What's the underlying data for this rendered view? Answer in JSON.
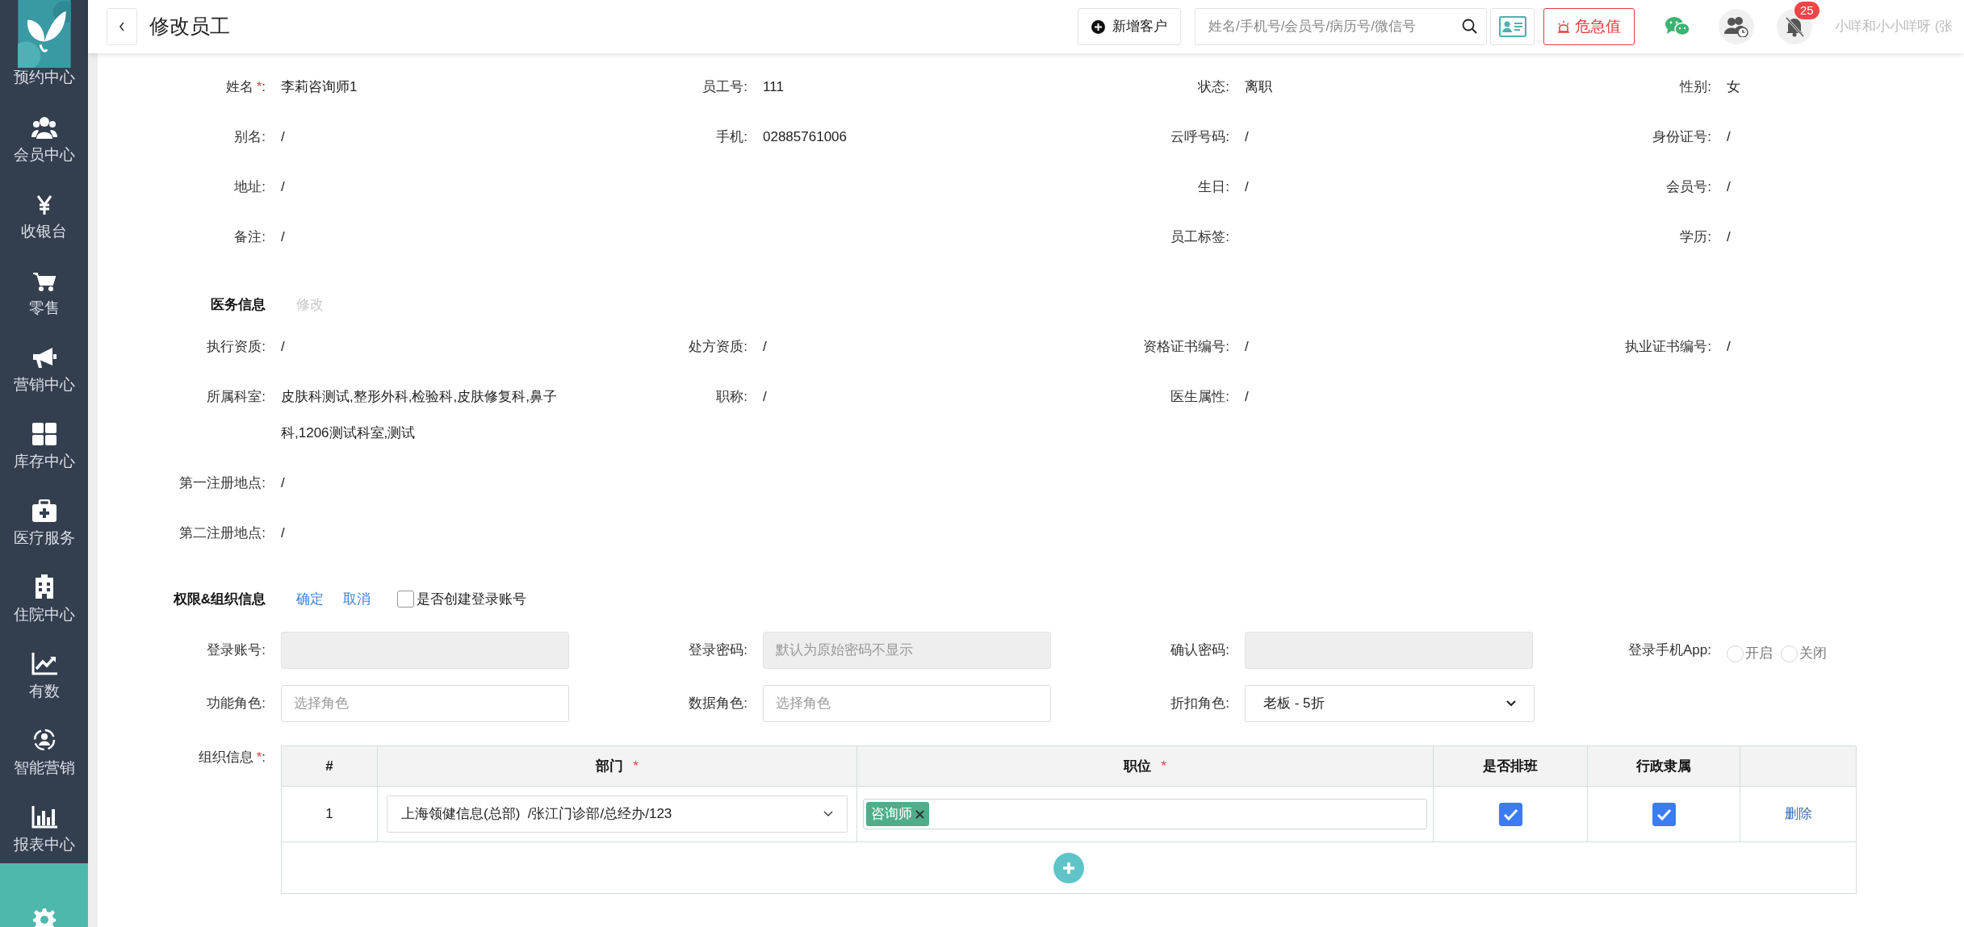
{
  "sidebar": {
    "items": [
      {
        "label": "预约中心",
        "selected": false
      },
      {
        "label": "会员中心",
        "selected": false
      },
      {
        "label": "收银台",
        "selected": false
      },
      {
        "label": "零售",
        "selected": false
      },
      {
        "label": "营销中心",
        "selected": false
      },
      {
        "label": "库存中心",
        "selected": false
      },
      {
        "label": "医疗服务",
        "selected": false
      },
      {
        "label": "住院中心",
        "selected": false
      },
      {
        "label": "有数",
        "selected": false
      },
      {
        "label": "智能营销",
        "selected": false
      },
      {
        "label": "报表中心",
        "selected": false
      },
      {
        "selected": true
      }
    ]
  },
  "header": {
    "title": "修改员工",
    "new_customer_button": "新增客户",
    "search": {
      "placeholder": "姓名/手机号/会员号/病历号/微信号"
    },
    "alert_button": "危急值",
    "notification_count": "25",
    "user_name": "小咩和小小咩呀 (张"
  },
  "basic_info": {
    "rows": [
      [
        {
          "label": "姓名",
          "required_mark": "*",
          "label_end": ":",
          "value": "李莉咨询师1"
        },
        {
          "label": "员工号:",
          "value": "111"
        },
        {
          "label": "状态:",
          "value": "离职"
        },
        {
          "label": "性别:",
          "value": "女"
        }
      ],
      [
        {
          "label": "别名:",
          "value": "/"
        },
        {
          "label": "手机:",
          "value": "02885761006"
        },
        {
          "label": "云呼号码:",
          "value": "/"
        },
        {
          "label": "身份证号:",
          "value": "/"
        }
      ],
      [
        {
          "label": "地址:",
          "value": "/"
        },
        null,
        {
          "label": "生日:",
          "value": "/"
        },
        {
          "label": "会员号:",
          "value": "/"
        }
      ],
      [
        {
          "label": "备注:",
          "value": "/"
        },
        null,
        {
          "label": "员工标签:"
        },
        {
          "label": "学历:",
          "value": "/"
        }
      ]
    ]
  },
  "medical_info": {
    "title": "医务信息",
    "edit_link": {
      "label": "修改",
      "disabled": true
    },
    "rows": [
      [
        {
          "label": "执行资质:",
          "value": "/"
        },
        {
          "label": "处方资质:",
          "value": "/"
        },
        {
          "label": "资格证书编号:",
          "value": "/"
        },
        {
          "label": "执业证书编号:",
          "value": "/"
        }
      ],
      [
        {
          "label": "所属科室:",
          "value": "皮肤科测试,整形外科,检验科,皮肤修复科,鼻子科,1206测试科室,测试"
        },
        {
          "label": "职称:",
          "value": "/"
        },
        {
          "label": "医生属性:",
          "value": "/"
        }
      ],
      [
        {
          "label": "第一注册地点:",
          "value": "/"
        }
      ],
      [
        {
          "label": "第二注册地点:",
          "value": "/"
        }
      ]
    ]
  },
  "permissions": {
    "title": "权限&组织信息",
    "confirm_link": "确定",
    "cancel_link": "取消",
    "create_account": {
      "label": "是否创建登录账号",
      "checked": false
    },
    "form_rows": [
      [
        {
          "kind": "input",
          "label": "登录账号:",
          "disabled": true
        },
        {
          "kind": "input",
          "label": "登录密码:",
          "disabled": true,
          "placeholder": "默认为原始密码不显示"
        },
        {
          "kind": "input",
          "label": "确认密码:",
          "disabled": true
        },
        {
          "kind": "radios",
          "label": "登录手机App:",
          "options": [
            {
              "label": "开启",
              "selected": false
            },
            {
              "label": "关闭",
              "selected": false
            }
          ]
        }
      ],
      [
        {
          "kind": "input",
          "label": "功能角色:",
          "disabled": false,
          "placeholder": "选择角色"
        },
        {
          "kind": "input",
          "label": "数据角色:",
          "disabled": false,
          "placeholder": "选择角色"
        },
        {
          "kind": "select",
          "label": "折扣角色:",
          "value": "老板 - 5折"
        }
      ]
    ],
    "org": {
      "label": "组织信息",
      "required_mark": "*",
      "label_end": ":",
      "columns": [
        {
          "label": "#"
        },
        {
          "label": "部门",
          "required_mark": "*"
        },
        {
          "label": "职位",
          "required_mark": "*"
        },
        {
          "label": "是否排班"
        },
        {
          "label": "行政隶属"
        },
        {}
      ],
      "rows": [
        {
          "index": "1",
          "department": "上海领健信息(总部)  /张江门诊部/总经办/123",
          "positions": [
            "咨询师"
          ],
          "scheduled": true,
          "admin": true,
          "delete_link": "删除"
        }
      ]
    }
  }
}
